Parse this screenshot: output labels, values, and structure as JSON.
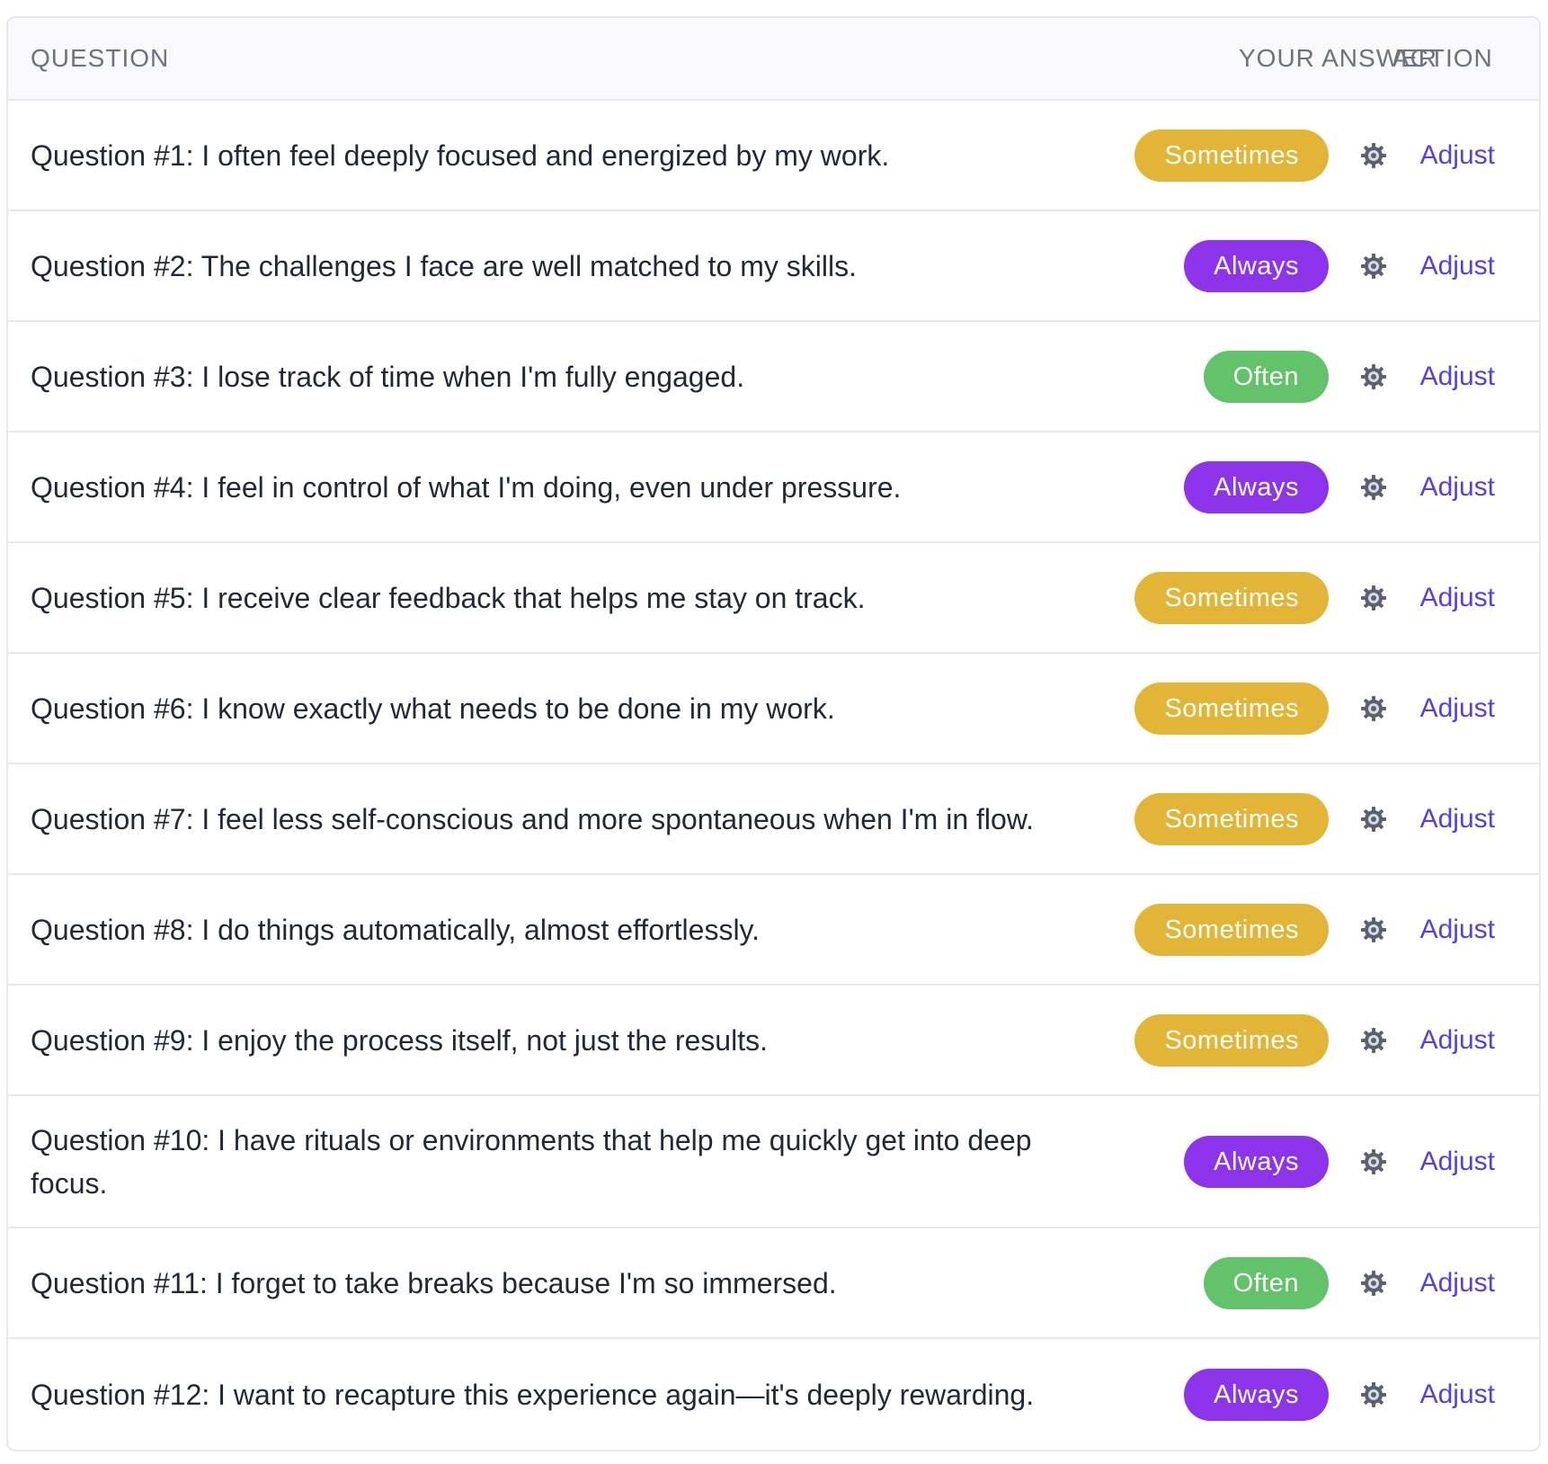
{
  "table": {
    "headers": {
      "question": "QUESTION",
      "answer": "YOUR ANSWER",
      "action": "ACTION"
    },
    "answer_colors": {
      "Sometimes": "#e3b536",
      "Always": "#8d33ea",
      "Often": "#63c36b"
    },
    "action_icon": "gear-icon",
    "rows": [
      {
        "question": "Question #1: I often feel deeply focused and energized by my work.",
        "answer": "Sometimes",
        "action": "Adjust"
      },
      {
        "question": "Question #2: The challenges I face are well matched to my skills.",
        "answer": "Always",
        "action": "Adjust"
      },
      {
        "question": "Question #3: I lose track of time when I'm fully engaged.",
        "answer": "Often",
        "action": "Adjust"
      },
      {
        "question": "Question #4: I feel in control of what I'm doing, even under pressure.",
        "answer": "Always",
        "action": "Adjust"
      },
      {
        "question": "Question #5: I receive clear feedback that helps me stay on track.",
        "answer": "Sometimes",
        "action": "Adjust"
      },
      {
        "question": "Question #6: I know exactly what needs to be done in my work.",
        "answer": "Sometimes",
        "action": "Adjust"
      },
      {
        "question": "Question #7: I feel less self-conscious and more spontaneous when I'm in flow.",
        "answer": "Sometimes",
        "action": "Adjust"
      },
      {
        "question": "Question #8: I do things automatically, almost effortlessly.",
        "answer": "Sometimes",
        "action": "Adjust"
      },
      {
        "question": "Question #9: I enjoy the process itself, not just the results.",
        "answer": "Sometimes",
        "action": "Adjust"
      },
      {
        "question": "Question #10: I have rituals or environments that help me quickly get into deep focus.",
        "answer": "Always",
        "action": "Adjust"
      },
      {
        "question": "Question #11: I forget to take breaks because I'm so immersed.",
        "answer": "Often",
        "action": "Adjust"
      },
      {
        "question": "Question #12: I want to recapture this experience again—it's deeply rewarding.",
        "answer": "Always",
        "action": "Adjust"
      }
    ]
  }
}
